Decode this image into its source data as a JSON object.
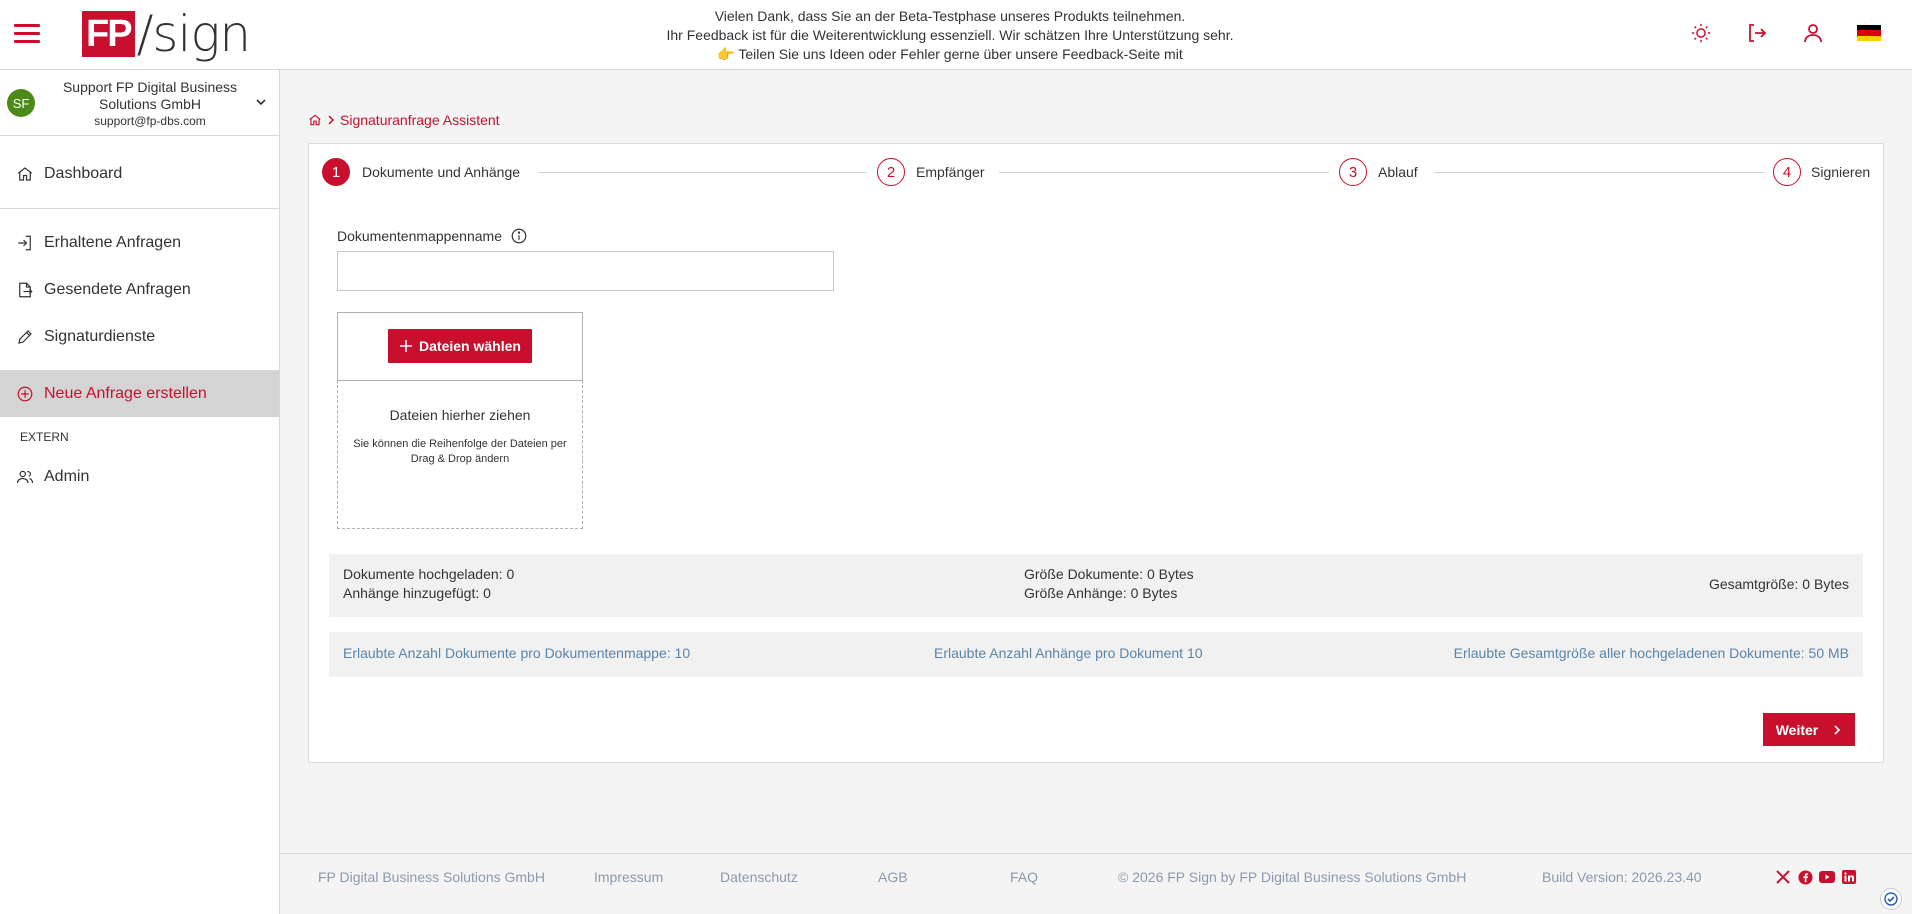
{
  "header": {
    "logo_fp": "FP",
    "logo_sign": "/sign",
    "beta_line1": "Vielen Dank, dass Sie an der Beta-Testphase unseres Produkts teilnehmen.",
    "beta_line2": "Ihr Feedback ist für die Weiterentwicklung essenziell. Wir schätzen Ihre Unterstützung sehr.",
    "beta_line3": "👉 Teilen Sie uns Ideen oder Fehler gerne über unsere Feedback-Seite mit",
    "icons": [
      "theme-sun-icon",
      "logout-icon",
      "user-icon",
      "german-flag-icon"
    ]
  },
  "user": {
    "initials": "SF",
    "name": "Support FP Digital Business Solutions GmbH",
    "email": "support@fp-dbs.com"
  },
  "sidebar": {
    "items": [
      {
        "label": "Dashboard",
        "icon": "home-icon"
      },
      {
        "label": "Erhaltene Anfragen",
        "icon": "inbox-in-icon"
      },
      {
        "label": "Gesendete Anfragen",
        "icon": "sent-icon"
      },
      {
        "label": "Signaturdienste",
        "icon": "pencil-icon"
      },
      {
        "label": "Neue Anfrage erstellen",
        "icon": "plus-circle-icon"
      }
    ],
    "extern_caption": "EXTERN",
    "admin_label": "Admin"
  },
  "breadcrumb": {
    "current": "Signaturanfrage Assistent"
  },
  "stepper": [
    {
      "number": "1",
      "label": "Dokumente und Anhänge",
      "active": true
    },
    {
      "number": "2",
      "label": "Empfänger",
      "active": false
    },
    {
      "number": "3",
      "label": "Ablauf",
      "active": false
    },
    {
      "number": "4",
      "label": "Signieren",
      "active": false
    }
  ],
  "form": {
    "folder_name_label": "Dokumentenmappenname",
    "folder_name_value": "",
    "choose_files": "Dateien wählen",
    "drop_title": "Dateien hierher ziehen",
    "drop_hint": "Sie können die Reihenfolge der Dateien per Drag & Drop ändern"
  },
  "stats": {
    "docs_uploaded": "Dokumente hochgeladen:  0",
    "attachments_added": "Anhänge hinzugefügt:  0",
    "doc_size": "Größe Dokumente:  0 Bytes",
    "attachment_size": "Größe Anhänge:  0 Bytes",
    "total_size": "Gesamtgröße:  0 Bytes"
  },
  "limits": {
    "docs_per_folder": "Erlaubte Anzahl Dokumente pro Dokumentenmappe:  10",
    "attachments_per_doc": "Erlaubte Anzahl Anhänge pro Dokument 10",
    "total_size": "Erlaubte Gesamtgröße aller hochgeladenen Dokumente:  50 MB"
  },
  "next_button": "Weiter",
  "footer": {
    "company": "FP Digital Business Solutions GmbH",
    "impressum": "Impressum",
    "datenschutz": "Datenschutz",
    "agb": "AGB",
    "faq": "FAQ",
    "copyright": "© 2026 FP Sign by FP Digital Business Solutions GmbH",
    "build": "Build Version: 2026.23.40",
    "social_icons": [
      "x-icon",
      "facebook-icon",
      "youtube-icon",
      "linkedin-icon"
    ]
  },
  "colors": {
    "brand_red": "#c8102e",
    "link_blue": "#5a84a8",
    "avatar_green": "#4c8a17"
  }
}
